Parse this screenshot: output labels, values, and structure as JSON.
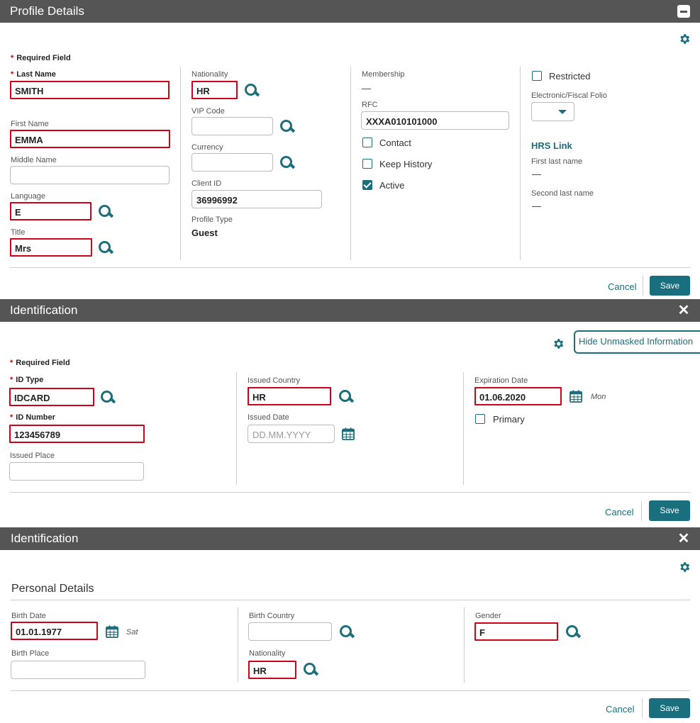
{
  "profile": {
    "title": "Profile Details",
    "required_note": "Required Field",
    "last_name": {
      "label": "Last Name",
      "value": "SMITH"
    },
    "first_name": {
      "label": "First Name",
      "value": "EMMA"
    },
    "middle_name": {
      "label": "Middle Name",
      "value": ""
    },
    "language": {
      "label": "Language",
      "value": "E"
    },
    "title_field": {
      "label": "Title",
      "value": "Mrs"
    },
    "nationality": {
      "label": "Nationality",
      "value": "HR"
    },
    "vip_code": {
      "label": "VIP Code",
      "value": ""
    },
    "currency": {
      "label": "Currency",
      "value": ""
    },
    "client_id": {
      "label": "Client ID",
      "value": "36996992"
    },
    "profile_type": {
      "label": "Profile Type",
      "value": "Guest"
    },
    "membership": {
      "label": "Membership",
      "value": "—"
    },
    "rfc": {
      "label": "RFC",
      "value": "XXXA010101000"
    },
    "contact": {
      "label": "Contact",
      "checked": false
    },
    "keep_history": {
      "label": "Keep History",
      "checked": false
    },
    "active": {
      "label": "Active",
      "checked": true
    },
    "restricted": {
      "label": "Restricted",
      "checked": false
    },
    "fiscal_folio": {
      "label": "Electronic/Fiscal Folio",
      "value": ""
    },
    "hrs_link": "HRS Link",
    "first_last_name": {
      "label": "First last name",
      "value": "—"
    },
    "second_last_name": {
      "label": "Second last name",
      "value": "—"
    },
    "cancel": "Cancel",
    "save": "Save"
  },
  "identification": {
    "title": "Identification",
    "hide_unmasked": "Hide Unmasked Information",
    "required_note": "Required Field",
    "id_type": {
      "label": "ID Type",
      "value": "IDCARD"
    },
    "id_number": {
      "label": "ID Number",
      "value": "123456789"
    },
    "issued_place": {
      "label": "Issued Place",
      "value": ""
    },
    "issued_country": {
      "label": "Issued Country",
      "value": "HR"
    },
    "issued_date": {
      "label": "Issued Date",
      "placeholder": "DD.MM.YYYY"
    },
    "expiration_date": {
      "label": "Expiration Date",
      "value": "01.06.2020",
      "day": "Mon"
    },
    "primary": {
      "label": "Primary",
      "checked": false
    },
    "cancel": "Cancel",
    "save": "Save"
  },
  "personal": {
    "title": "Identification",
    "section": "Personal Details",
    "birth_date": {
      "label": "Birth Date",
      "value": "01.01.1977",
      "day": "Sat"
    },
    "birth_place": {
      "label": "Birth Place",
      "value": ""
    },
    "birth_country": {
      "label": "Birth Country",
      "value": ""
    },
    "nationality": {
      "label": "Nationality",
      "value": "HR"
    },
    "gender": {
      "label": "Gender",
      "value": "F"
    },
    "cancel": "Cancel",
    "save": "Save"
  },
  "colors": {
    "accent": "#1a6f7e",
    "header": "#555555",
    "highlight": "#d0021b"
  },
  "icons": [
    "minus-icon",
    "close-icon",
    "gear-icon",
    "search-icon",
    "calendar-icon",
    "chevron-down-icon"
  ]
}
